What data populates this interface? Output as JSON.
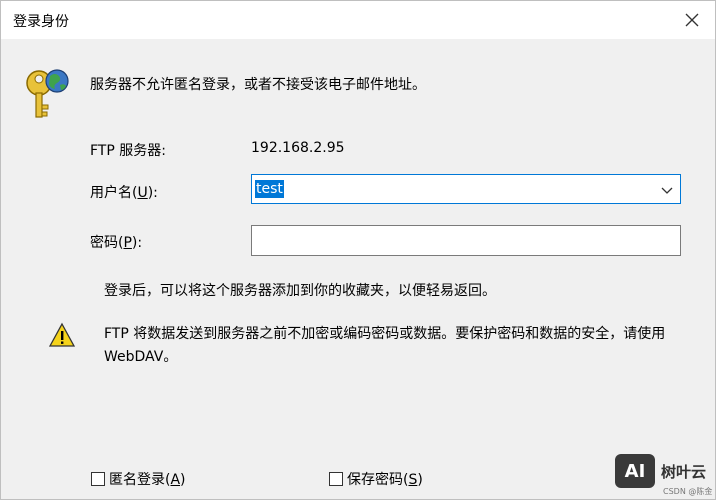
{
  "window": {
    "title": "登录身份"
  },
  "message": "服务器不允许匿名登录，或者不接受该电子邮件地址。",
  "fields": {
    "server_label": "FTP 服务器:",
    "server_value": "192.168.2.95",
    "username_label_pre": "用户名(",
    "username_label_key": "U",
    "username_label_post": "):",
    "username_value": "test",
    "password_label_pre": "密码(",
    "password_label_key": "P",
    "password_label_post": "):",
    "password_value": ""
  },
  "info": "登录后，可以将这个服务器添加到你的收藏夹，以便轻易返回。",
  "warning": "FTP 将数据发送到服务器之前不加密或编码密码或数据。要保护密码和数据的安全，请使用 WebDAV。",
  "checkboxes": {
    "anonymous_pre": "匿名登录(",
    "anonymous_key": "A",
    "anonymous_post": ")",
    "anonymous_checked": false,
    "save_pre": "保存密码(",
    "save_key": "S",
    "save_post": ")",
    "save_checked": false
  },
  "watermark": {
    "badge": "AI",
    "name": "树叶云",
    "sub": "CSDN @陈金"
  },
  "colors": {
    "accent": "#0078d7",
    "background": "#f0f0f0"
  }
}
